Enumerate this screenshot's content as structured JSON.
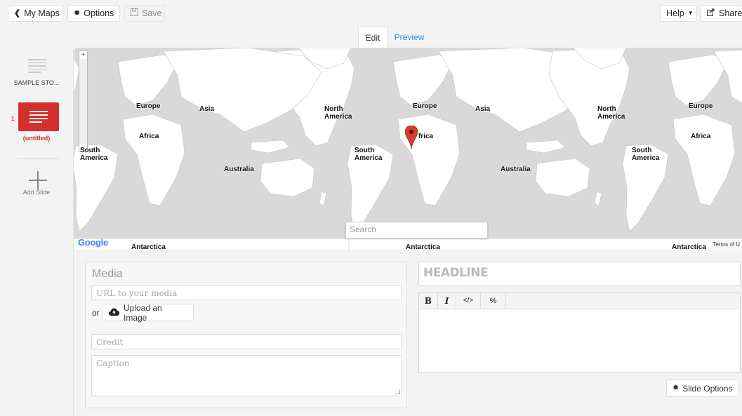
{
  "toolbar": {
    "my_maps_label": "My Maps",
    "options_label": "Options",
    "save_label": "Save",
    "help_label": "Help",
    "share_label": "Share"
  },
  "tabs": {
    "edit_label": "Edit",
    "preview_label": "Preview"
  },
  "sidebar": {
    "title_slide_label": "SAMPLE STO...",
    "slide_number": "1",
    "slide_label": "(untitled)",
    "add_slide_label": "Add Slide"
  },
  "map": {
    "search_placeholder": "Search",
    "google_label": "Google",
    "terms_label": "Terms of U",
    "zoom_in": "+",
    "zoom_out": "−",
    "labels": {
      "europe": "Europe",
      "asia": "Asia",
      "africa": "Africa",
      "north": "North",
      "america": "America",
      "south": "South",
      "australia": "Australia",
      "antarctica": "Antarctica",
      "south_clipped": "South",
      "america_clipped": "America",
      "africa_marker": "frica"
    }
  },
  "media": {
    "heading": "Media",
    "url_placeholder": "URL to your media",
    "or_label": "or",
    "upload_label": "Upload an Image",
    "credit_placeholder": "Credit",
    "caption_placeholder": "Caption"
  },
  "text": {
    "headline_placeholder": "HEADLINE",
    "bold_label": "B",
    "italic_label": "I",
    "code_label": "</>",
    "link_label": "%",
    "slide_options_label": "Slide Options"
  },
  "colors": {
    "accent_red": "#d32f2f",
    "link_blue": "#3a8fd6",
    "map_water": "#d9d9d9",
    "map_land": "#ffffff"
  }
}
